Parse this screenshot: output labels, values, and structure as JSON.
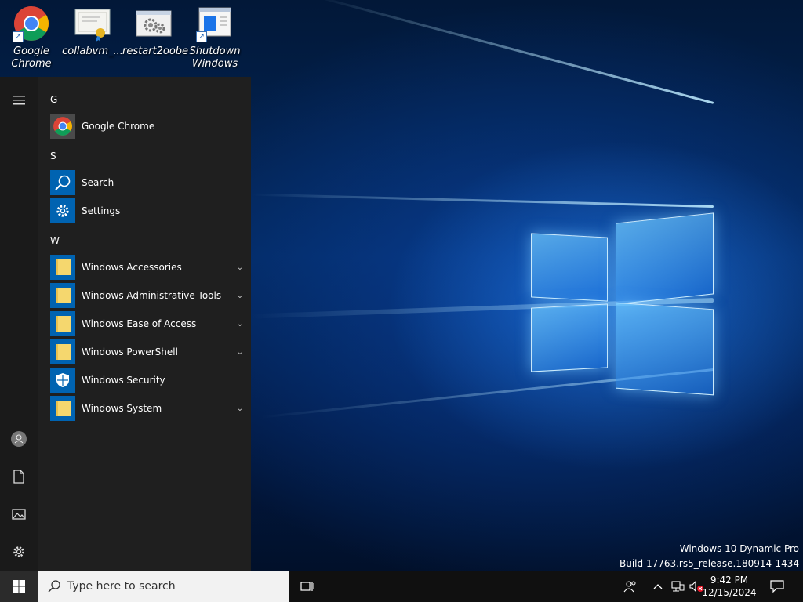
{
  "desktop_icons": [
    {
      "line1": "Google",
      "line2": "Chrome",
      "icon": "chrome-icon"
    },
    {
      "line1": "collabvm_...",
      "line2": "",
      "icon": "certificate-icon"
    },
    {
      "line1": "restart2oobe",
      "line2": "",
      "icon": "gears-icon"
    },
    {
      "line1": "Shutdown",
      "line2": "Windows",
      "icon": "window-icon"
    }
  ],
  "start_menu": {
    "groups": [
      {
        "letter": "G",
        "apps": [
          {
            "label": "Google Chrome",
            "icon": "chrome-icon"
          }
        ]
      },
      {
        "letter": "S",
        "apps": [
          {
            "label": "Search",
            "icon": "search-icon"
          },
          {
            "label": "Settings",
            "icon": "gear-icon"
          }
        ]
      },
      {
        "letter": "W",
        "apps": [
          {
            "label": "Windows Accessories",
            "icon": "folder-icon",
            "expandable": true
          },
          {
            "label": "Windows Administrative Tools",
            "icon": "folder-icon",
            "expandable": true
          },
          {
            "label": "Windows Ease of Access",
            "icon": "folder-icon",
            "expandable": true
          },
          {
            "label": "Windows PowerShell",
            "icon": "folder-icon",
            "expandable": true
          },
          {
            "label": "Windows Security",
            "icon": "shield-icon",
            "expandable": false
          },
          {
            "label": "Windows System",
            "icon": "folder-icon",
            "expandable": true
          }
        ]
      }
    ],
    "rail_icons": [
      "hamburger-menu-icon",
      "user-icon",
      "document-icon",
      "pictures-icon",
      "gear-icon",
      "power-icon"
    ]
  },
  "watermark": {
    "line1": "Windows 10 Dynamic Pro",
    "line2": "Build 17763.rs5_release.180914-1434"
  },
  "taskbar": {
    "search_placeholder": "Type here to search",
    "time": "9:42 PM",
    "date": "12/15/2024"
  },
  "colors": {
    "accent": "#0063b1",
    "start_bg": "#1f1f1f",
    "taskbar_bg": "#101010"
  }
}
